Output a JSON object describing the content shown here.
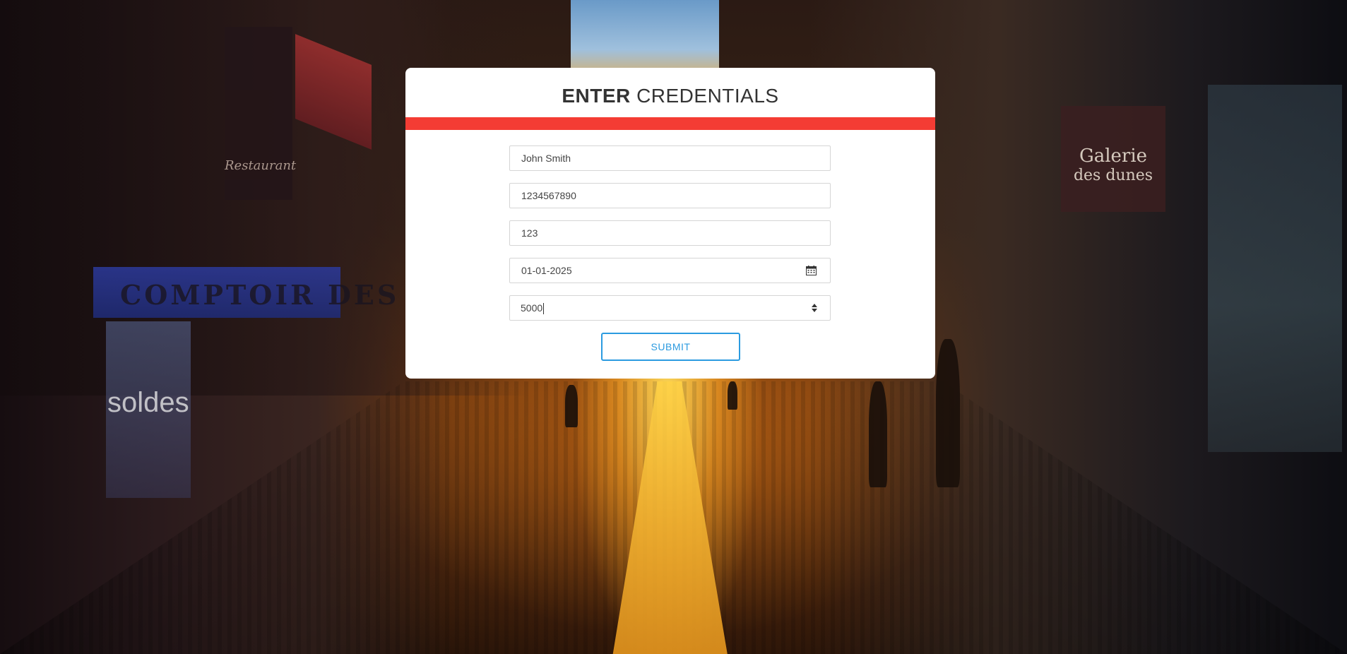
{
  "form": {
    "title_bold": "ENTER",
    "title_rest": "CREDENTIALS",
    "accent_color": "#f43c34",
    "fields": {
      "name": "John Smith",
      "phone": "1234567890",
      "cvv": "123",
      "date": "01-01-2025",
      "amount": "5000"
    },
    "submit_label": "SUBMIT",
    "submit_color": "#2c9be0"
  },
  "background": {
    "signs": {
      "shop": "COMPTOIR DES ISLES",
      "gallery_line1": "Galerie",
      "gallery_line2": "des dunes",
      "restaurant": "Restaurant",
      "sale": "soldes"
    }
  }
}
